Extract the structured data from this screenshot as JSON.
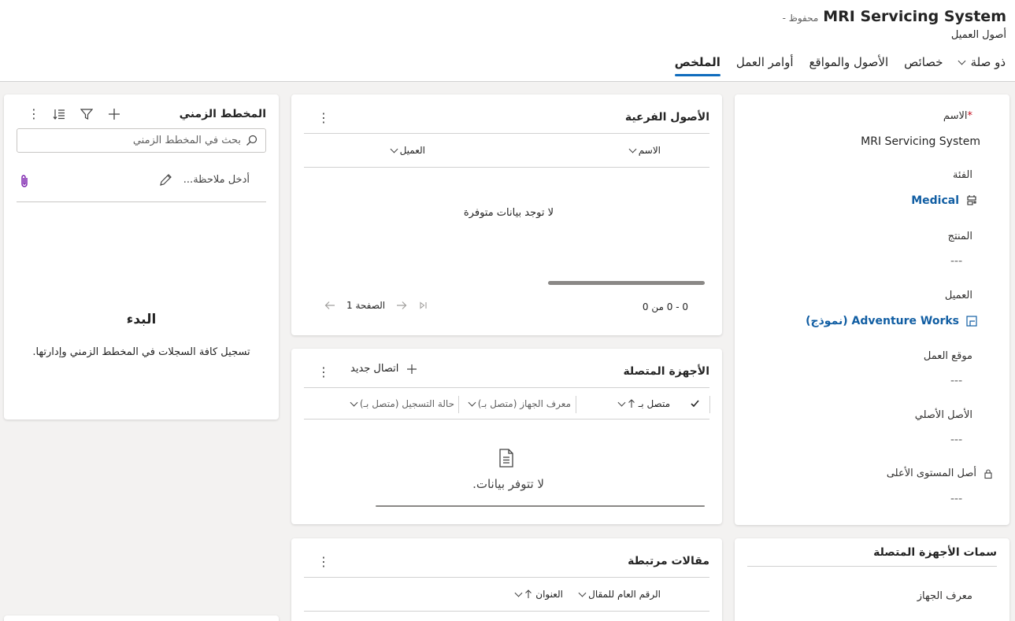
{
  "header": {
    "title": "MRI Servicing System",
    "status": "- محفوظ",
    "entity_type": "أصول العميل"
  },
  "tabs": [
    {
      "label": "الملخص",
      "active": true
    },
    {
      "label": "أوامر العمل",
      "active": false
    },
    {
      "label": "الأصول والمواقع",
      "active": false
    },
    {
      "label": "خصائص",
      "active": false
    },
    {
      "label": "ذو صلة",
      "active": false
    }
  ],
  "details": {
    "name_label": "الاسم",
    "required_mark": "*",
    "name_value": "MRI Servicing System",
    "category_label": "الفئة",
    "category_value": "Medical",
    "product_label": "المنتج",
    "product_value": "---",
    "account_label": "العميل",
    "account_value": "Adventure Works (نموذج)",
    "functional_location_label": "موقع العمل",
    "functional_location_value": "---",
    "parent_asset_label": "الأصل الأصلي",
    "parent_asset_value": "---",
    "top_level_asset_label": "أصل المستوى الأعلى",
    "top_level_asset_value": "---"
  },
  "iot_attributes": {
    "title": "سمات الأجهزة المتصلة",
    "device_id_label": "معرف الجهاز"
  },
  "sub_assets": {
    "title": "الأصول الفرعية",
    "columns": [
      "الاسم",
      "العميل"
    ],
    "empty_text": "لا توجد بيانات متوفرة",
    "range_text": "0 - 0 من 0",
    "page_text": "الصفحة 1"
  },
  "connected_devices": {
    "title": "الأجهزة المتصلة",
    "new_connection_label": "اتصال جديد",
    "columns": [
      "متصل بـ",
      "معرف الجهاز (متصل بـ)",
      "حالة التسجيل (متصل بـ)"
    ],
    "empty_text": "لا تتوفر بيانات."
  },
  "related_articles": {
    "title": "مقالات مرتبطة",
    "columns": [
      "الرقم العام للمقال",
      "العنوان"
    ]
  },
  "timeline": {
    "title": "المخطط الزمني",
    "search_placeholder": "بحث في المخطط الزمني",
    "note_placeholder": "أدخل ملاحظة...",
    "empty_title": "البدء",
    "empty_text": "تسجيل كافة السجلات في المخطط الزمني وإدارتها."
  },
  "colors": {
    "accent": "#0f6cbd",
    "link": "#115ea3",
    "required": "#c50f1f",
    "background": "#f3f2f1"
  },
  "icons": {
    "category": "category-icon",
    "account": "account-record-icon",
    "lock": "lock-icon",
    "add": "plus-icon",
    "filter": "filter-icon",
    "sort": "sort-list-icon",
    "search": "search-icon",
    "edit": "pencil-icon",
    "attach": "paperclip-icon",
    "document": "document-icon"
  }
}
